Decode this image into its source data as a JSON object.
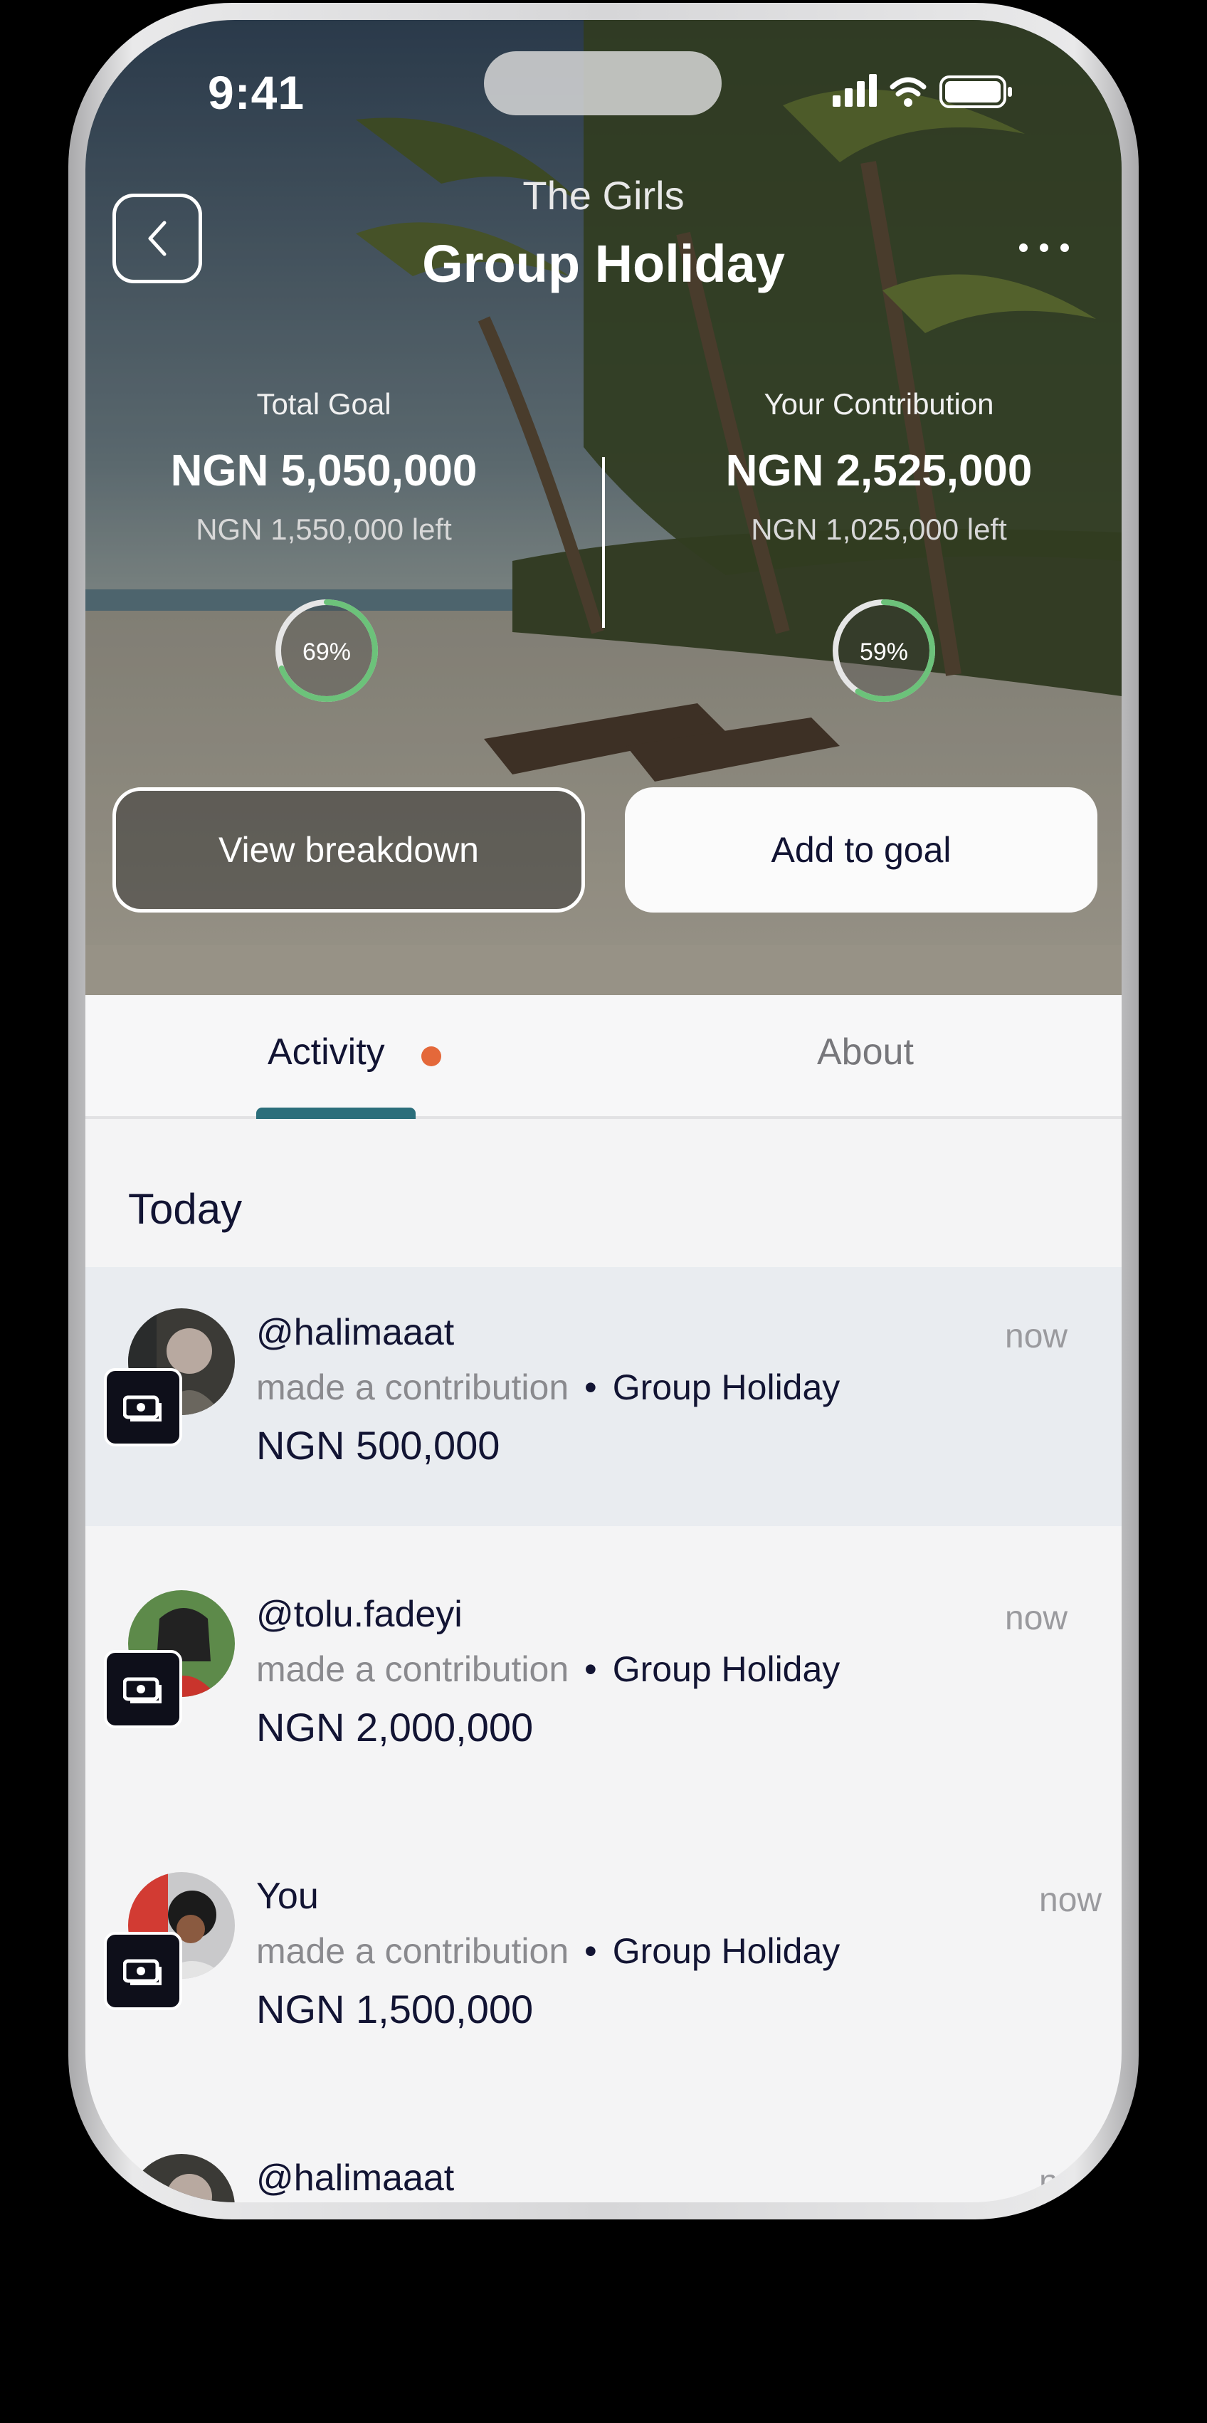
{
  "status_bar": {
    "time": "9:41"
  },
  "header": {
    "group_name": "The Girls",
    "goal_title": "Group Holiday"
  },
  "stats": {
    "total": {
      "label": "Total Goal",
      "amount": "NGN 5,050,000",
      "left": "NGN 1,550,000 left",
      "progress_percent": 69,
      "progress_label": "69%"
    },
    "mine": {
      "label": "Your Contribution",
      "amount": "NGN 2,525,000",
      "left": "NGN 1,025,000 left",
      "progress_percent": 59,
      "progress_label": "59%"
    }
  },
  "buttons": {
    "breakdown": "View breakdown",
    "add": "Add to goal"
  },
  "tabs": [
    {
      "label": "Activity"
    },
    {
      "label": "About"
    }
  ],
  "section_title": "Today",
  "activities": [
    {
      "user": "@halimaaat",
      "action": "made a contribution",
      "separator": "•",
      "goal": "Group Holiday",
      "amount": "NGN 500,000",
      "time": "now"
    },
    {
      "user": "@tolu.fadeyi",
      "action": "made a contribution",
      "separator": "•",
      "goal": "Group Holiday",
      "amount": "NGN 2,000,000",
      "time": "now"
    },
    {
      "user": "You",
      "action": "made a contribution",
      "separator": "•",
      "goal": "Group Holiday",
      "amount": "NGN 1,500,000",
      "time": "now"
    },
    {
      "user": "@halimaaat",
      "time": "n"
    }
  ],
  "colors": {
    "accent_tab": "#2b6e7b",
    "notification_dot": "#e4683a",
    "progress_ring": "#6cc27a",
    "text_dark": "#121433"
  }
}
